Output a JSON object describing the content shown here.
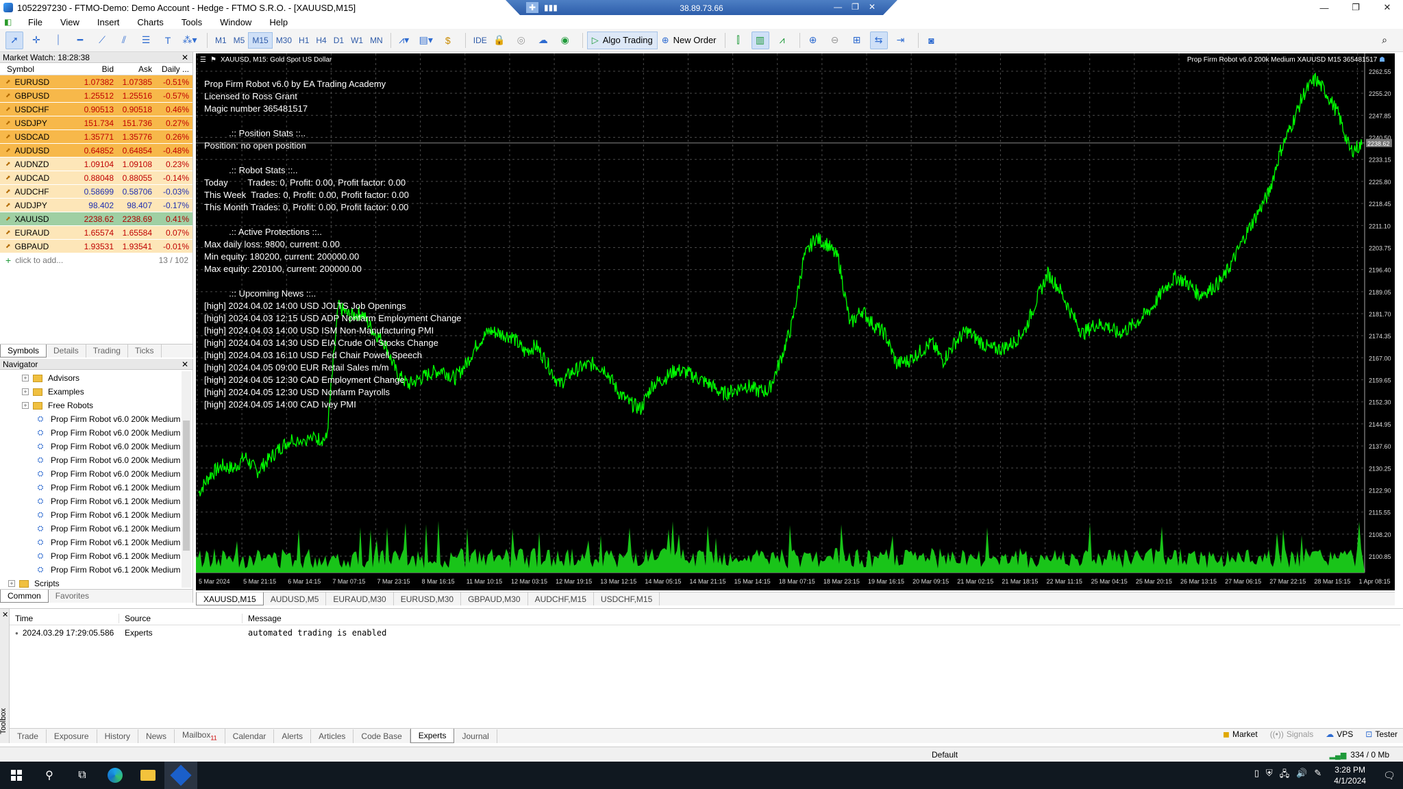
{
  "window": {
    "title": "1052297230 - FTMO-Demo: Demo Account - Hedge - FTMO S.R.O. - [XAUUSD,M15]",
    "controls": [
      "—",
      "❐",
      "✕"
    ]
  },
  "rdp": {
    "ip": "38.89.73.66",
    "pin": "✚",
    "signal": "▮▮▮",
    "controls": [
      "—",
      "❐",
      "✕"
    ]
  },
  "menu": {
    "items": [
      "File",
      "View",
      "Insert",
      "Charts",
      "Tools",
      "Window",
      "Help"
    ],
    "logo": "◧"
  },
  "toolbar": {
    "timeframes": [
      "M1",
      "M5",
      "M15",
      "M30",
      "H1",
      "H4",
      "D1",
      "W1",
      "MN"
    ],
    "active_timeframe": "M15",
    "ide_label": "IDE",
    "algo_label": "Algo Trading",
    "new_order_label": "New Order"
  },
  "market_watch": {
    "title": "Market Watch: 18:28:38",
    "columns": {
      "symbol": "Symbol",
      "bid": "Bid",
      "ask": "Ask",
      "daily": "Daily ..."
    },
    "rows": [
      {
        "symbol": "EURUSD",
        "bid": "1.07382",
        "ask": "1.07385",
        "daily": "-0.51%",
        "style": "hl-orange"
      },
      {
        "symbol": "GBPUSD",
        "bid": "1.25512",
        "ask": "1.25516",
        "daily": "-0.57%",
        "style": "hl-orange"
      },
      {
        "symbol": "USDCHF",
        "bid": "0.90513",
        "ask": "0.90518",
        "daily": "0.46%",
        "style": "hl-orange"
      },
      {
        "symbol": "USDJPY",
        "bid": "151.734",
        "ask": "151.736",
        "daily": "0.27%",
        "style": "hl-orange"
      },
      {
        "symbol": "USDCAD",
        "bid": "1.35771",
        "ask": "1.35776",
        "daily": "0.26%",
        "style": "hl-orange"
      },
      {
        "symbol": "AUDUSD",
        "bid": "0.64852",
        "ask": "0.64854",
        "daily": "-0.48%",
        "style": "hl-orange"
      },
      {
        "symbol": "AUDNZD",
        "bid": "1.09104",
        "ask": "1.09108",
        "daily": "0.23%",
        "style": "hl-light"
      },
      {
        "symbol": "AUDCAD",
        "bid": "0.88048",
        "ask": "0.88055",
        "daily": "-0.14%",
        "style": "hl-light"
      },
      {
        "symbol": "AUDCHF",
        "bid": "0.58699",
        "ask": "0.58706",
        "daily": "-0.03%",
        "style": "hl-light blue-num"
      },
      {
        "symbol": "AUDJPY",
        "bid": "98.402",
        "ask": "98.407",
        "daily": "-0.17%",
        "style": "hl-light blue-num"
      },
      {
        "symbol": "XAUUSD",
        "bid": "2238.62",
        "ask": "2238.69",
        "daily": "0.41%",
        "style": "hl-green"
      },
      {
        "symbol": "EURAUD",
        "bid": "1.65574",
        "ask": "1.65584",
        "daily": "0.07%",
        "style": "hl-light"
      },
      {
        "symbol": "GBPAUD",
        "bid": "1.93531",
        "ask": "1.93541",
        "daily": "-0.01%",
        "style": "hl-light"
      }
    ],
    "add_label": "click to add...",
    "count": "13 / 102",
    "tabs": [
      "Symbols",
      "Details",
      "Trading",
      "Ticks"
    ]
  },
  "navigator": {
    "title": "Navigator",
    "folders": [
      "Advisors",
      "Examples",
      "Free Robots"
    ],
    "robots": [
      "Prop Firm Robot v6.0 200k Medium",
      "Prop Firm Robot v6.0 200k Medium",
      "Prop Firm Robot v6.0 200k Medium",
      "Prop Firm Robot v6.0 200k Medium",
      "Prop Firm Robot v6.0 200k Medium",
      "Prop Firm Robot v6.1 200k Medium",
      "Prop Firm Robot v6.1 200k Medium",
      "Prop Firm Robot v6.1 200k Medium",
      "Prop Firm Robot v6.1 200k Medium",
      "Prop Firm Robot v6.1 200k Medium",
      "Prop Firm Robot v6.1 200k Medium",
      "Prop Firm Robot v6.1 200k Medium"
    ],
    "scripts_label": "Scripts",
    "tabs": [
      "Common",
      "Favorites"
    ]
  },
  "chart": {
    "header_left": "XAUUSD, M15:  Gold Spot US Dollar",
    "header_right": "Prop Firm Robot v6.0 200k Medium XAUUSD M15 365481517",
    "overlay_lines": [
      "Prop Firm Robot v6.0 by EA Trading Academy",
      "Licensed to Ross Grant",
      "Magic number 365481517",
      "",
      "          .:: Position Stats ::..",
      "Position: no open position",
      "",
      "          .:: Robot Stats ::..",
      "Today        Trades: 0, Profit: 0.00, Profit factor: 0.00",
      "This Week  Trades: 0, Profit: 0.00, Profit factor: 0.00",
      "This Month Trades: 0, Profit: 0.00, Profit factor: 0.00",
      "",
      "          .:: Active Protections ::..",
      "Max daily loss: 9800, current: 0.00",
      "Min equity: 180200, current: 200000.00",
      "Max equity: 220100, current: 200000.00",
      "",
      "          .:: Upcoming News ::..",
      "[high] 2024.04.02 14:00 USD JOLTS Job Openings",
      "[high] 2024.04.03 12:15 USD ADP Nonfarm Employment Change",
      "[high] 2024.04.03 14:00 USD ISM Non-Manufacturing PMI",
      "[high] 2024.04.03 14:30 USD EIA Crude Oil Stocks Change",
      "[high] 2024.04.03 16:10 USD Fed Chair Powell Speech",
      "[high] 2024.04.05 09:00 EUR Retail Sales m/m",
      "[high] 2024.04.05 12:30 CAD Employment Change",
      "[high] 2024.04.05 12:30 USD Nonfarm Payrolls",
      "[high] 2024.04.05 14:00 CAD Ivey PMI"
    ],
    "tabs": [
      "XAUUSD,M15",
      "AUDUSD,M5",
      "EURAUD,M30",
      "EURUSD,M30",
      "GBPAUD,M30",
      "AUDCHF,M15",
      "USDCHF,M15"
    ]
  },
  "chart_data": {
    "type": "line",
    "title": "XAUUSD, M15:  Gold Spot US Dollar",
    "line_color": "#00ff00",
    "ylim": [
      2100.85,
      2262.55
    ],
    "y_ticks": [
      "2262.55",
      "2255.20",
      "2247.85",
      "2240.50",
      "2233.15",
      "2225.80",
      "2218.45",
      "2211.10",
      "2203.75",
      "2196.40",
      "2189.05",
      "2181.70",
      "2174.35",
      "2167.00",
      "2159.65",
      "2152.30",
      "2144.95",
      "2137.60",
      "2130.25",
      "2122.90",
      "2115.55",
      "2108.20",
      "2100.85"
    ],
    "x_ticks": [
      "5 Mar 2024",
      "5 Mar 21:15",
      "6 Mar 14:15",
      "7 Mar 07:15",
      "7 Mar 23:15",
      "8 Mar 16:15",
      "11 Mar 10:15",
      "12 Mar 03:15",
      "12 Mar 19:15",
      "13 Mar 12:15",
      "14 Mar 05:15",
      "14 Mar 21:15",
      "15 Mar 14:15",
      "18 Mar 07:15",
      "18 Mar 23:15",
      "19 Mar 16:15",
      "20 Mar 09:15",
      "21 Mar 02:15",
      "21 Mar 18:15",
      "22 Mar 11:15",
      "25 Mar 04:15",
      "25 Mar 20:15",
      "26 Mar 13:15",
      "27 Mar 06:15",
      "27 Mar 22:15",
      "28 Mar 15:15",
      "1 Apr 08:15"
    ],
    "price_series": [
      [
        0,
        2122
      ],
      [
        0.01,
        2128
      ],
      [
        0.02,
        2131
      ],
      [
        0.03,
        2130
      ],
      [
        0.04,
        2134
      ],
      [
        0.05,
        2129
      ],
      [
        0.06,
        2133
      ],
      [
        0.07,
        2137
      ],
      [
        0.08,
        2140
      ],
      [
        0.1,
        2140
      ],
      [
        0.11,
        2140
      ],
      [
        0.12,
        2184
      ],
      [
        0.13,
        2181
      ],
      [
        0.14,
        2182
      ],
      [
        0.15,
        2176
      ],
      [
        0.16,
        2172
      ],
      [
        0.17,
        2162
      ],
      [
        0.18,
        2158
      ],
      [
        0.19,
        2160
      ],
      [
        0.2,
        2162
      ],
      [
        0.21,
        2163
      ],
      [
        0.22,
        2160
      ],
      [
        0.23,
        2165
      ],
      [
        0.24,
        2172
      ],
      [
        0.25,
        2176
      ],
      [
        0.26,
        2175
      ],
      [
        0.27,
        2174
      ],
      [
        0.28,
        2169
      ],
      [
        0.29,
        2171
      ],
      [
        0.3,
        2165
      ],
      [
        0.31,
        2158
      ],
      [
        0.32,
        2162
      ],
      [
        0.33,
        2164
      ],
      [
        0.34,
        2165
      ],
      [
        0.35,
        2163
      ],
      [
        0.36,
        2156
      ],
      [
        0.37,
        2152
      ],
      [
        0.38,
        2150
      ],
      [
        0.39,
        2158
      ],
      [
        0.4,
        2160
      ],
      [
        0.41,
        2163
      ],
      [
        0.42,
        2162
      ],
      [
        0.43,
        2160
      ],
      [
        0.44,
        2158
      ],
      [
        0.45,
        2155
      ],
      [
        0.46,
        2156
      ],
      [
        0.47,
        2158
      ],
      [
        0.48,
        2156
      ],
      [
        0.49,
        2156
      ],
      [
        0.5,
        2166
      ],
      [
        0.51,
        2178
      ],
      [
        0.52,
        2200
      ],
      [
        0.53,
        2207
      ],
      [
        0.54,
        2205
      ],
      [
        0.55,
        2200
      ],
      [
        0.56,
        2178
      ],
      [
        0.57,
        2183
      ],
      [
        0.58,
        2178
      ],
      [
        0.59,
        2175
      ],
      [
        0.6,
        2165
      ],
      [
        0.61,
        2166
      ],
      [
        0.62,
        2169
      ],
      [
        0.63,
        2172
      ],
      [
        0.64,
        2166
      ],
      [
        0.65,
        2172
      ],
      [
        0.66,
        2176
      ],
      [
        0.67,
        2173
      ],
      [
        0.68,
        2170
      ],
      [
        0.69,
        2170
      ],
      [
        0.7,
        2172
      ],
      [
        0.71,
        2176
      ],
      [
        0.72,
        2186
      ],
      [
        0.73,
        2195
      ],
      [
        0.74,
        2190
      ],
      [
        0.75,
        2182
      ],
      [
        0.76,
        2175
      ],
      [
        0.77,
        2178
      ],
      [
        0.78,
        2178
      ],
      [
        0.79,
        2175
      ],
      [
        0.8,
        2177
      ],
      [
        0.81,
        2180
      ],
      [
        0.82,
        2184
      ],
      [
        0.83,
        2190
      ],
      [
        0.84,
        2194
      ],
      [
        0.85,
        2192
      ],
      [
        0.86,
        2188
      ],
      [
        0.87,
        2190
      ],
      [
        0.88,
        2193
      ],
      [
        0.89,
        2200
      ],
      [
        0.9,
        2208
      ],
      [
        0.91,
        2215
      ],
      [
        0.92,
        2222
      ],
      [
        0.93,
        2236
      ],
      [
        0.94,
        2245
      ],
      [
        0.95,
        2255
      ],
      [
        0.96,
        2260
      ],
      [
        0.97,
        2255
      ],
      [
        0.98,
        2248
      ],
      [
        0.99,
        2236
      ],
      [
        1.0,
        2238
      ]
    ],
    "current_price": "2238.62",
    "gridlines": true
  },
  "toolbox": {
    "side_label": "Toolbox",
    "columns": {
      "time": "Time",
      "source": "Source",
      "message": "Message"
    },
    "rows": [
      {
        "time": "2024.03.29 17:29:05.586",
        "source": "Experts",
        "message": "automated trading is enabled"
      }
    ],
    "tabs": [
      "Trade",
      "Exposure",
      "History",
      "News",
      "Mailbox",
      "Calendar",
      "Alerts",
      "Articles",
      "Code Base",
      "Experts",
      "Journal"
    ],
    "mailbox_badge": "11",
    "active_tab": "Experts",
    "right": {
      "market": "Market",
      "signals": "Signals",
      "vps": "VPS",
      "tester": "Tester"
    }
  },
  "statusbar": {
    "profile": "Default",
    "traffic": "334 / 0 Mb"
  },
  "taskbar": {
    "time": "3:28 PM",
    "date": "4/1/2024"
  }
}
